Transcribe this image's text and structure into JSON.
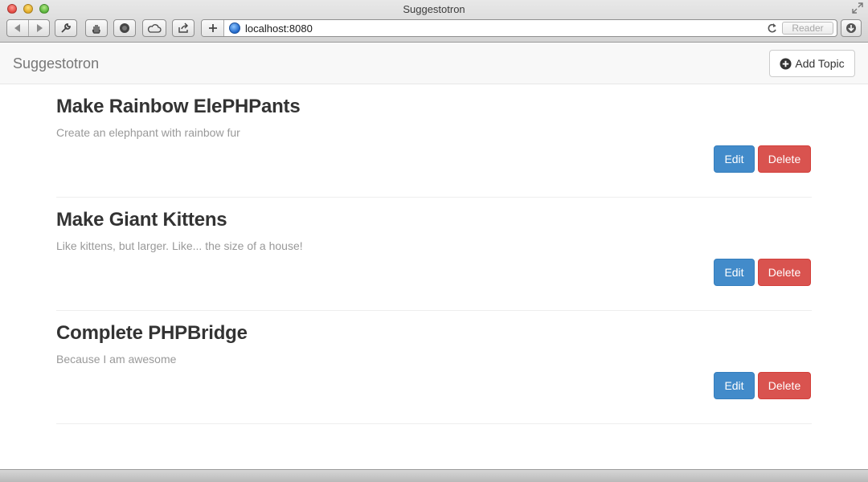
{
  "window": {
    "title": "Suggestotron"
  },
  "toolbar": {
    "url": "localhost:8080",
    "reader_label": "Reader"
  },
  "navbar": {
    "brand": "Suggestotron",
    "add_topic_label": "Add Topic"
  },
  "topics": [
    {
      "title": "Make Rainbow ElePHPants",
      "description": "Create an elephpant with rainbow fur",
      "edit_label": "Edit",
      "delete_label": "Delete"
    },
    {
      "title": "Make Giant Kittens",
      "description": "Like kittens, but larger. Like... the size of a house!",
      "edit_label": "Edit",
      "delete_label": "Delete"
    },
    {
      "title": "Complete PHPBridge",
      "description": "Because I am awesome",
      "edit_label": "Edit",
      "delete_label": "Delete"
    }
  ],
  "icons": {
    "add_topic": "plus-circle-icon",
    "url_site": "globe-icon"
  },
  "colors": {
    "edit_button": "#428bca",
    "delete_button": "#d9534f",
    "navbar_bg": "#f8f8f8",
    "heading": "#333333",
    "muted_text": "#999999"
  }
}
